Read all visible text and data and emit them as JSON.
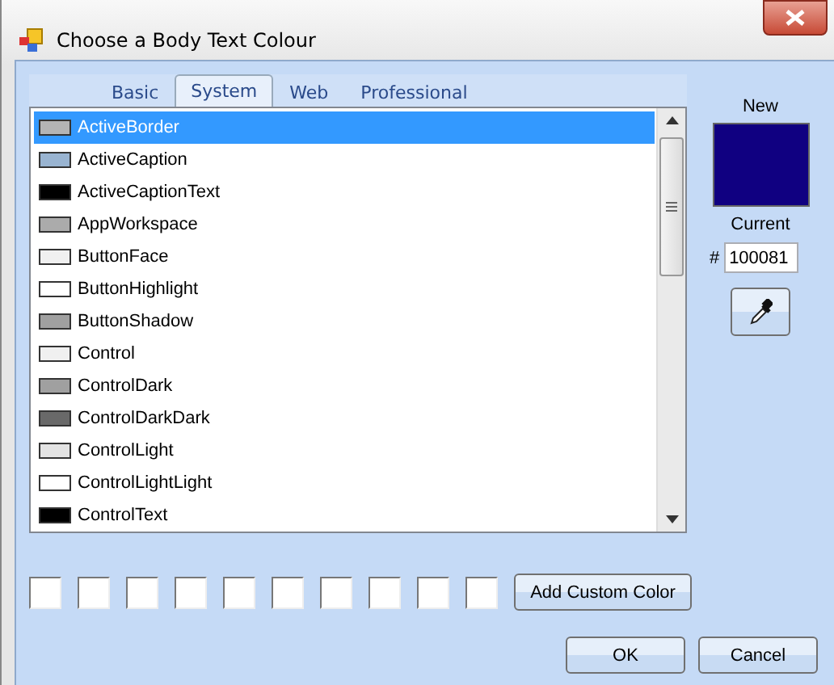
{
  "window": {
    "title": "Choose a Body Text Colour"
  },
  "tabs": [
    {
      "label": "Basic",
      "selected": false
    },
    {
      "label": "System",
      "selected": true
    },
    {
      "label": "Web",
      "selected": false
    },
    {
      "label": "Professional",
      "selected": false
    }
  ],
  "colors": [
    {
      "name": "ActiveBorder",
      "color": "#b4b4b4",
      "selected": true
    },
    {
      "name": "ActiveCaption",
      "color": "#99b4d1",
      "selected": false
    },
    {
      "name": "ActiveCaptionText",
      "color": "#000000",
      "selected": false
    },
    {
      "name": "AppWorkspace",
      "color": "#ababab",
      "selected": false
    },
    {
      "name": "ButtonFace",
      "color": "#f0f0f0",
      "selected": false
    },
    {
      "name": "ButtonHighlight",
      "color": "#ffffff",
      "selected": false
    },
    {
      "name": "ButtonShadow",
      "color": "#a0a0a0",
      "selected": false
    },
    {
      "name": "Control",
      "color": "#f0f0f0",
      "selected": false
    },
    {
      "name": "ControlDark",
      "color": "#a0a0a0",
      "selected": false
    },
    {
      "name": "ControlDarkDark",
      "color": "#696969",
      "selected": false
    },
    {
      "name": "ControlLight",
      "color": "#e3e3e3",
      "selected": false
    },
    {
      "name": "ControlLightLight",
      "color": "#ffffff",
      "selected": false
    },
    {
      "name": "ControlText",
      "color": "#000000",
      "selected": false
    }
  ],
  "preview": {
    "new_label": "New",
    "current_label": "Current",
    "color": "#100081",
    "hash": "#",
    "hex": "100081"
  },
  "custom_colors": [
    {
      "color": "#ffffff"
    },
    {
      "color": "#ffffff"
    },
    {
      "color": "#ffffff"
    },
    {
      "color": "#ffffff"
    },
    {
      "color": "#ffffff"
    },
    {
      "color": "#ffffff"
    },
    {
      "color": "#ffffff"
    },
    {
      "color": "#ffffff"
    },
    {
      "color": "#ffffff"
    },
    {
      "color": "#ffffff"
    }
  ],
  "add_custom": "Add Custom Color",
  "buttons": [
    "OK",
    "Cancel"
  ]
}
